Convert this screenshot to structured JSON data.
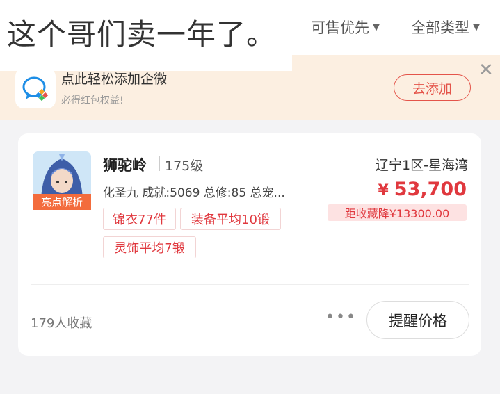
{
  "overlay": {
    "caption": "这个哥们卖一年了。"
  },
  "filters": [
    {
      "label": "可售优先",
      "icon": "caret-down-icon"
    },
    {
      "label": "全部类型",
      "icon": "caret-down-icon"
    }
  ],
  "banner": {
    "icon": "wecom-icon",
    "title": "点此轻松添加企微",
    "subtitle": "必得红包权益!",
    "button_label": "去添加",
    "close_icon": "close-icon"
  },
  "listing": {
    "avatar_tag": "亮点解析",
    "school": "狮驼岭",
    "level": "175级",
    "server": "辽宁1区-星海湾",
    "description": "化圣九 成就:5069 总修:85 总宠...",
    "price_currency": "¥",
    "price_value": "53,700",
    "price_drop": "距收藏降¥13300.00",
    "tags": [
      "锦衣77件",
      "装备平均10锻",
      "灵饰平均7锻"
    ],
    "favorites": "179人收藏",
    "more_label": "•••",
    "remind_button": "提醒价格"
  },
  "colors": {
    "accent": "#e0383e",
    "banner_bg": "#fcefe1",
    "tag_orange": "#f36c3d"
  }
}
